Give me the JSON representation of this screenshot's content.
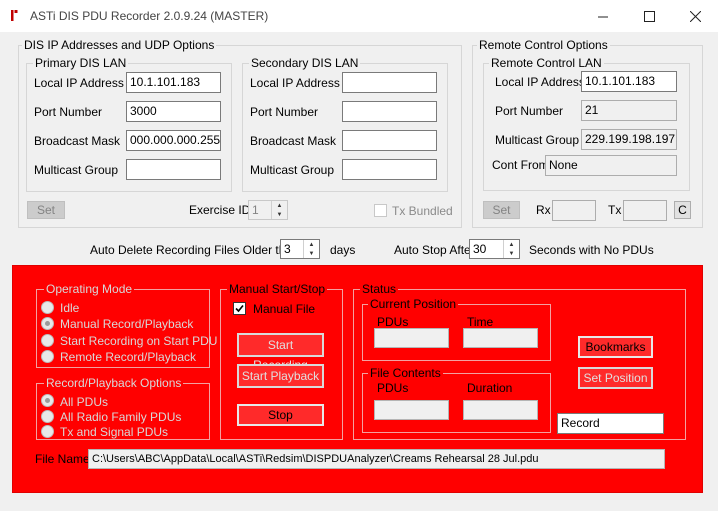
{
  "window": {
    "title": "ASTi DIS PDU Recorder 2.0.9.24 (MASTER)",
    "minimize_glyph": "—",
    "maximize_glyph": "☐",
    "close_glyph": "✕"
  },
  "dis": {
    "group_label": "DIS IP Addresses and UDP Options",
    "primary": {
      "label": "Primary DIS LAN",
      "local_ip_label": "Local IP Address",
      "local_ip": "10.1.101.183",
      "port_label": "Port Number",
      "port": "3000",
      "bcast_label": "Broadcast Mask",
      "bcast": "000.000.000.255",
      "mcast_label": "Multicast Group",
      "mcast": ""
    },
    "secondary": {
      "label": "Secondary DIS LAN",
      "local_ip_label": "Local IP Address",
      "local_ip": "",
      "port_label": "Port Number",
      "port": "",
      "bcast_label": "Broadcast Mask",
      "bcast": "",
      "mcast_label": "Multicast Group",
      "mcast": ""
    },
    "set_label": "Set",
    "exercise_label": "Exercise ID",
    "exercise_id": "1",
    "tx_bundled_label": "Tx Bundled"
  },
  "remote": {
    "group_label": "Remote Control Options",
    "lan_label": "Remote Control LAN",
    "local_ip_label": "Local IP Address",
    "local_ip": "10.1.101.183",
    "port_label": "Port Number",
    "port": "21",
    "mcast_label": "Multicast Group",
    "mcast": "229.199.198.197",
    "cont_from_label": "Cont From",
    "cont_from": "None",
    "set_label": "Set",
    "rx_label": "Rx",
    "rx": "",
    "tx_label": "Tx",
    "tx": "",
    "c_label": "C"
  },
  "auto": {
    "delete_label": "Auto Delete Recording Files Older than",
    "delete_value": "3",
    "days_label": "days",
    "stop_label": "Auto Stop After",
    "stop_value": "30",
    "stop_suffix": "Seconds with No PDUs"
  },
  "operating_mode": {
    "label": "Operating Mode",
    "options": [
      "Idle",
      "Manual Record/Playback",
      "Start Recording on Start PDU",
      "Remote Record/Playback"
    ],
    "selected": 1
  },
  "record_options": {
    "label": "Record/Playback Options",
    "options": [
      "All PDUs",
      "All Radio Family PDUs",
      "Tx and Signal PDUs"
    ],
    "selected": 0
  },
  "manual": {
    "label": "Manual Start/Stop",
    "manual_file_label": "Manual File",
    "start_recording": "Start Recording",
    "start_playback": "Start Playback",
    "stop": "Stop"
  },
  "status": {
    "label": "Status",
    "current_label": "Current Position",
    "pdus_label": "PDUs",
    "time_label": "Time",
    "file_label": "File Contents",
    "file_pdus_label": "PDUs",
    "duration_label": "Duration",
    "bookmarks": "Bookmarks",
    "set_position": "Set Position",
    "mode_value": "Record"
  },
  "file": {
    "label": "File Name",
    "path": "C:\\Users\\ABC\\AppData\\Local\\ASTi\\Redsim\\DISPDUAnalyzer\\Creams Rehearsal 28 Jul.pdu"
  }
}
